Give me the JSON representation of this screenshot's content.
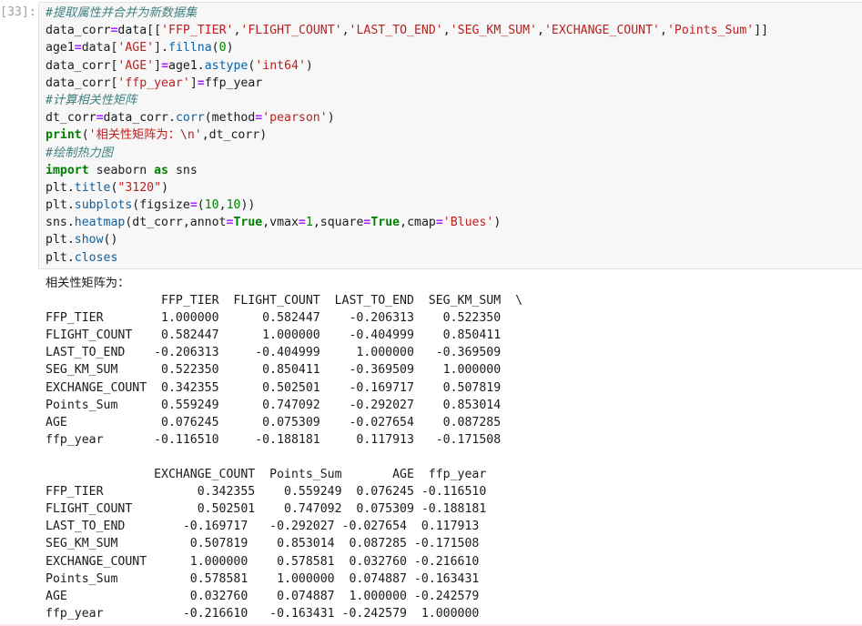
{
  "prompt": "[33]:",
  "code_lines": [
    [
      {
        "c": "cm",
        "t": "#提取属性并合并为新数据集"
      }
    ],
    [
      {
        "c": "def",
        "t": "data_corr"
      },
      {
        "c": "op",
        "t": "="
      },
      {
        "c": "def",
        "t": "data[["
      },
      {
        "c": "str",
        "t": "'FFP_TIER'"
      },
      {
        "c": "def",
        "t": ","
      },
      {
        "c": "str",
        "t": "'FLIGHT_COUNT'"
      },
      {
        "c": "def",
        "t": ","
      },
      {
        "c": "str",
        "t": "'LAST_TO_END'"
      },
      {
        "c": "def",
        "t": ","
      },
      {
        "c": "str",
        "t": "'SEG_KM_SUM'"
      },
      {
        "c": "def",
        "t": ","
      },
      {
        "c": "str",
        "t": "'EXCHANGE_COUNT'"
      },
      {
        "c": "def",
        "t": ","
      },
      {
        "c": "str",
        "t": "'Points_Sum'"
      },
      {
        "c": "def",
        "t": "]]"
      }
    ],
    [
      {
        "c": "def",
        "t": "age1"
      },
      {
        "c": "op",
        "t": "="
      },
      {
        "c": "def",
        "t": "data["
      },
      {
        "c": "str",
        "t": "'AGE'"
      },
      {
        "c": "def",
        "t": "]."
      },
      {
        "c": "fn",
        "t": "fillna"
      },
      {
        "c": "def",
        "t": "("
      },
      {
        "c": "num",
        "t": "0"
      },
      {
        "c": "def",
        "t": ")"
      }
    ],
    [
      {
        "c": "def",
        "t": "data_corr["
      },
      {
        "c": "str",
        "t": "'AGE'"
      },
      {
        "c": "def",
        "t": "]"
      },
      {
        "c": "op",
        "t": "="
      },
      {
        "c": "def",
        "t": "age1."
      },
      {
        "c": "fn",
        "t": "astype"
      },
      {
        "c": "def",
        "t": "("
      },
      {
        "c": "str",
        "t": "'int64'"
      },
      {
        "c": "def",
        "t": ")"
      }
    ],
    [
      {
        "c": "def",
        "t": "data_corr["
      },
      {
        "c": "str",
        "t": "'ffp_year'"
      },
      {
        "c": "def",
        "t": "]"
      },
      {
        "c": "op",
        "t": "="
      },
      {
        "c": "def",
        "t": "ffp_year"
      }
    ],
    [
      {
        "c": "cm",
        "t": "#计算相关性矩阵"
      }
    ],
    [
      {
        "c": "def",
        "t": "dt_corr"
      },
      {
        "c": "op",
        "t": "="
      },
      {
        "c": "def",
        "t": "data_corr."
      },
      {
        "c": "fn",
        "t": "corr"
      },
      {
        "c": "def",
        "t": "(method"
      },
      {
        "c": "op",
        "t": "="
      },
      {
        "c": "str",
        "t": "'pearson'"
      },
      {
        "c": "def",
        "t": ")"
      }
    ],
    [
      {
        "c": "kw",
        "t": "print"
      },
      {
        "c": "def",
        "t": "("
      },
      {
        "c": "str",
        "t": "'相关性矩阵为：\\n'"
      },
      {
        "c": "def",
        "t": ",dt_corr)"
      }
    ],
    [
      {
        "c": "cm",
        "t": "#绘制热力图"
      }
    ],
    [
      {
        "c": "kw",
        "t": "import"
      },
      {
        "c": "def",
        "t": " seaborn "
      },
      {
        "c": "kw",
        "t": "as"
      },
      {
        "c": "def",
        "t": " sns"
      }
    ],
    [
      {
        "c": "def",
        "t": "plt."
      },
      {
        "c": "fn",
        "t": "title"
      },
      {
        "c": "def",
        "t": "("
      },
      {
        "c": "str",
        "t": "\"3120\""
      },
      {
        "c": "def",
        "t": ")"
      }
    ],
    [
      {
        "c": "def",
        "t": "plt."
      },
      {
        "c": "fn",
        "t": "subplots"
      },
      {
        "c": "def",
        "t": "(figsize"
      },
      {
        "c": "op",
        "t": "="
      },
      {
        "c": "def",
        "t": "("
      },
      {
        "c": "num",
        "t": "10"
      },
      {
        "c": "def",
        "t": ","
      },
      {
        "c": "num",
        "t": "10"
      },
      {
        "c": "def",
        "t": "))"
      }
    ],
    [
      {
        "c": "def",
        "t": "sns."
      },
      {
        "c": "fn",
        "t": "heatmap"
      },
      {
        "c": "def",
        "t": "(dt_corr,annot"
      },
      {
        "c": "op",
        "t": "="
      },
      {
        "c": "kw",
        "t": "True"
      },
      {
        "c": "def",
        "t": ",vmax"
      },
      {
        "c": "op",
        "t": "="
      },
      {
        "c": "num",
        "t": "1"
      },
      {
        "c": "def",
        "t": ",square"
      },
      {
        "c": "op",
        "t": "="
      },
      {
        "c": "kw",
        "t": "True"
      },
      {
        "c": "def",
        "t": ",cmap"
      },
      {
        "c": "op",
        "t": "="
      },
      {
        "c": "str",
        "t": "'Blues'"
      },
      {
        "c": "def",
        "t": ")"
      }
    ],
    [
      {
        "c": "def",
        "t": "plt."
      },
      {
        "c": "fn",
        "t": "show"
      },
      {
        "c": "def",
        "t": "()"
      }
    ],
    [
      {
        "c": "def",
        "t": "plt."
      },
      {
        "c": "fn",
        "t": "closes"
      }
    ]
  ],
  "output": {
    "heading": "相关性矩阵为：",
    "table1_lines": [
      "                FFP_TIER  FLIGHT_COUNT  LAST_TO_END  SEG_KM_SUM  \\",
      "FFP_TIER        1.000000      0.582447    -0.206313    0.522350",
      "FLIGHT_COUNT    0.582447      1.000000    -0.404999    0.850411",
      "LAST_TO_END    -0.206313     -0.404999     1.000000   -0.369509",
      "SEG_KM_SUM      0.522350      0.850411    -0.369509    1.000000",
      "EXCHANGE_COUNT  0.342355      0.502501    -0.169717    0.507819",
      "Points_Sum      0.559249      0.747092    -0.292027    0.853014",
      "AGE             0.076245      0.075309    -0.027654    0.087285",
      "ffp_year       -0.116510     -0.188181     0.117913   -0.171508"
    ],
    "table2_lines": [
      "               EXCHANGE_COUNT  Points_Sum       AGE  ffp_year",
      "FFP_TIER             0.342355    0.559249  0.076245 -0.116510",
      "FLIGHT_COUNT         0.502501    0.747092  0.075309 -0.188181",
      "LAST_TO_END        -0.169717   -0.292027 -0.027654  0.117913",
      "SEG_KM_SUM          0.507819    0.853014  0.087285 -0.171508",
      "EXCHANGE_COUNT      1.000000    0.578581  0.032760 -0.216610",
      "Points_Sum          0.578581    1.000000  0.074887 -0.163431",
      "AGE                 0.032760    0.074887  1.000000 -0.242579",
      "ffp_year           -0.216610   -0.163431 -0.242579  1.000000"
    ]
  }
}
